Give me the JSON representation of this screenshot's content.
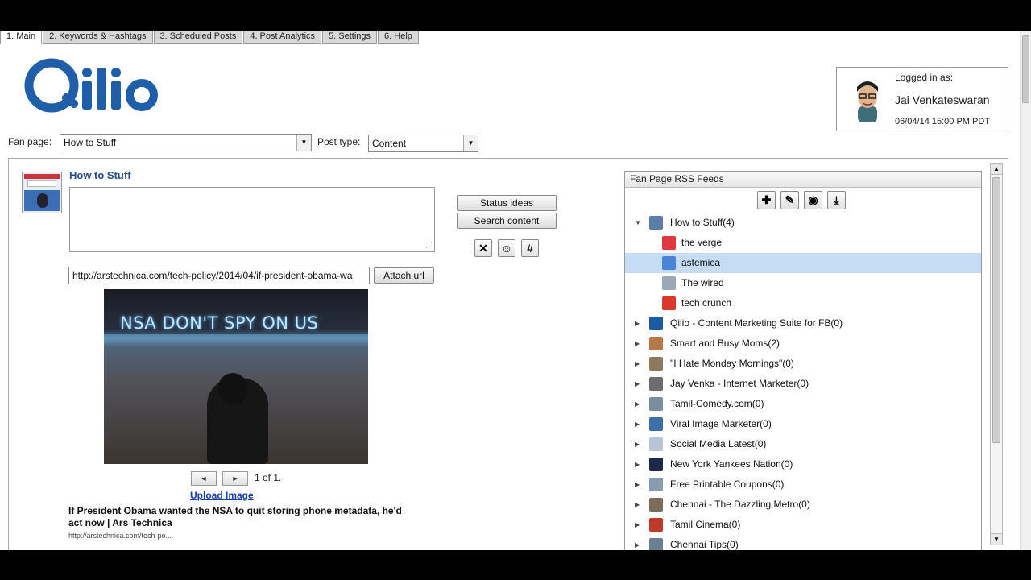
{
  "tabs": [
    "1. Main",
    "2. Keywords & Hashtags",
    "3. Scheduled Posts",
    "4. Post Analytics",
    "5. Settings",
    "6. Help"
  ],
  "logo_text": "Qilio",
  "login": {
    "label": "Logged in as:",
    "name": "Jai Venkateswaran",
    "datetime": "06/04/14 15:00 PM PDT"
  },
  "fan_page": {
    "label": "Fan page:",
    "value": "How to Stuff"
  },
  "post_type": {
    "label": "Post type:",
    "value": "Content"
  },
  "composer": {
    "page_title": "How to Stuff",
    "status_text": "",
    "status_ideas_label": "Status ideas",
    "search_content_label": "Search content",
    "url_value": "http://arstechnica.com/tech-policy/2014/04/if-president-obama-wa",
    "attach_label": "Attach url",
    "image_overlay_text": "NSA DON'T SPY ON US",
    "prev_label": "◄",
    "next_label": "►",
    "pager_text": "1 of 1.",
    "upload_label": "Upload Image",
    "article_title": "If President Obama wanted the NSA to quit storing phone metadata, he'd act now | Ars Technica",
    "article_url": "http://arstechnica.com/tech-po..."
  },
  "rss": {
    "title": "Fan Page RSS Feeds",
    "items": [
      {
        "label": "How to Stuff(4)",
        "level": 0,
        "expanded": true,
        "icon": "page-thumb-icon",
        "color": "#5a7ea8"
      },
      {
        "label": "the verge",
        "level": 1,
        "icon": "verge-icon",
        "color": "#e0383e"
      },
      {
        "label": "astemica",
        "level": 1,
        "selected": true,
        "icon": "google-icon",
        "color": "#4a84d6"
      },
      {
        "label": "The wired",
        "level": 1,
        "icon": "wired-icon",
        "color": "#9aa8b8"
      },
      {
        "label": "tech crunch",
        "level": 1,
        "icon": "techcrunch-icon",
        "color": "#d8392b"
      },
      {
        "label": "Qilio - Content Marketing Suite for FB(0)",
        "level": 0,
        "icon": "qilio-icon",
        "color": "#1e5aa3"
      },
      {
        "label": "Smart and Busy Moms(2)",
        "level": 0,
        "icon": "moms-thumb-icon",
        "color": "#b57848"
      },
      {
        "label": "\"I Hate Monday Mornings\"(0)",
        "level": 0,
        "icon": "monday-thumb-icon",
        "color": "#8a7a5e"
      },
      {
        "label": "Jay Venka - Internet Marketer(0)",
        "level": 0,
        "icon": "jay-thumb-icon",
        "color": "#6d6d6d"
      },
      {
        "label": "Tamil-Comedy.com(0)",
        "level": 0,
        "icon": "comedy-thumb-icon",
        "color": "#7b8c9e"
      },
      {
        "label": "Viral Image Marketer(0)",
        "level": 0,
        "icon": "viral-thumb-icon",
        "color": "#3e6fa9"
      },
      {
        "label": "Social Media Latest(0)",
        "level": 0,
        "icon": "social-thumb-icon",
        "color": "#b7c6d6"
      },
      {
        "label": "New York Yankees Nation(0)",
        "level": 0,
        "icon": "yankees-icon",
        "color": "#1c2a4a"
      },
      {
        "label": "Free Printable Coupons(0)",
        "level": 0,
        "icon": "coupons-thumb-icon",
        "color": "#8a9ab0"
      },
      {
        "label": "Chennai - The Dazzling Metro(0)",
        "level": 0,
        "icon": "chennai-thumb-icon",
        "color": "#7c6d5a"
      },
      {
        "label": "Tamil Cinema(0)",
        "level": 0,
        "icon": "cinema-thumb-icon",
        "color": "#c0392b"
      },
      {
        "label": "Chennai Tips(0)",
        "level": 0,
        "icon": "tips-thumb-icon",
        "color": "#6a7f92"
      }
    ]
  }
}
